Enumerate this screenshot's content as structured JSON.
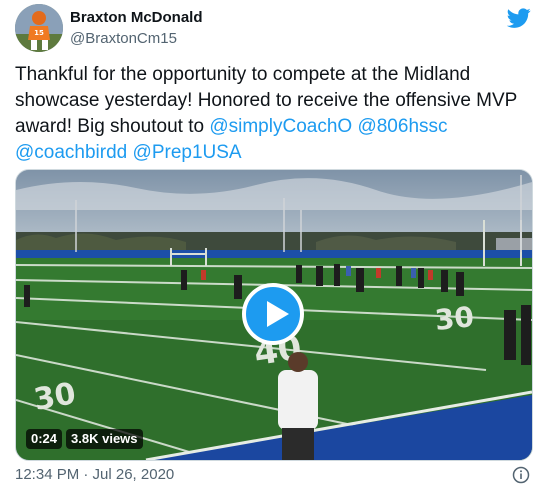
{
  "user": {
    "display_name": "Braxton McDonald",
    "handle": "@BraxtonCm15"
  },
  "tweet": {
    "text_segments": [
      {
        "text": "Thankful for the opportunity to compete at the Midland showcase yesterday! Honored to receive the offensive MVP award! Big shoutout to ",
        "type": "text"
      },
      {
        "text": "@simplyCoachO",
        "type": "mention"
      },
      {
        "text": " ",
        "type": "text"
      },
      {
        "text": "@806hssc",
        "type": "mention"
      },
      {
        "text": " ",
        "type": "text"
      },
      {
        "text": "@coachbirdd",
        "type": "mention"
      },
      {
        "text": " ",
        "type": "text"
      },
      {
        "text": "@Prep1USA",
        "type": "mention"
      }
    ]
  },
  "media": {
    "duration": "0:24",
    "views": "3.8K views",
    "play_icon": "play-icon"
  },
  "footer": {
    "timestamp": "12:34 PM · Jul 26, 2020",
    "info_icon": "info-icon"
  },
  "colors": {
    "accent": "#1d9bf0",
    "text": "#0f1419",
    "muted": "#536471"
  }
}
